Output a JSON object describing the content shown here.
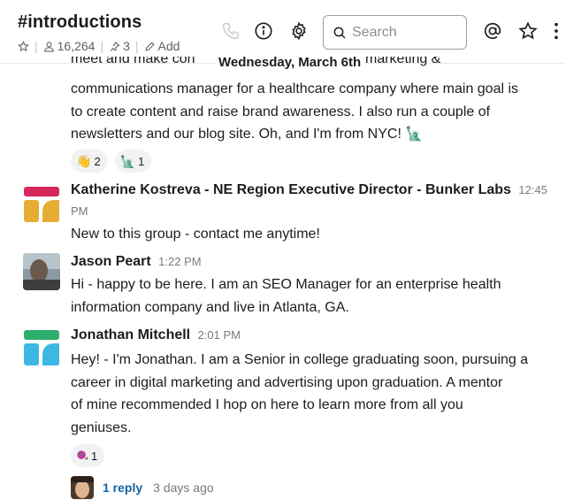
{
  "header": {
    "channel_name": "#introductions",
    "member_count": "16,264",
    "pinned_count": "3",
    "add_label": "Add",
    "search_placeholder": "Search",
    "icons": [
      "star-icon",
      "member-icon",
      "pin-icon",
      "pencil-icon",
      "phone-icon",
      "info-icon",
      "gear-icon",
      "search-icon",
      "at-icon",
      "star-icon",
      "more-vertical-icon"
    ]
  },
  "date_divider": "Wednesday, March 6th",
  "messages": [
    {
      "partial_top_left": "meet and make con",
      "partial_top_right": "marketing &",
      "lines": [
        "communications manager for a healthcare company where main goal is",
        "to create content and raise brand awareness. I also run a couple of",
        "newsletters and our blog site. Oh, and I'm from NYC! 🗽"
      ],
      "reactions": [
        {
          "emoji": "👋",
          "icon": "waving-hand-icon",
          "count": "2"
        },
        {
          "emoji": "🗽",
          "icon": "statue-of-liberty-icon",
          "count": "1"
        }
      ]
    },
    {
      "sender": "Katherine Kostreva - NE Region Executive Director - Bunker Labs",
      "time_a": "12:45",
      "time_b": "PM",
      "text": "New to this group - contact me anytime!",
      "avatar_colors": {
        "top": "#d6285a",
        "bottom": "#e5ad33"
      }
    },
    {
      "sender": "Jason Peart",
      "time": "1:22 PM",
      "lines": [
        "Hi - happy to be here. I am an SEO Manager for an enterprise health",
        "information company and live in Atlanta, GA."
      ]
    },
    {
      "sender": "Jonathan Mitchell",
      "time": "2:01 PM",
      "lines": [
        "Hey! - I'm Jonathan.  I am a Senior in college graduating soon, pursuing a",
        "career in digital marketing and advertising upon graduation.  A mentor",
        "of mine recommended I hop on here to learn more from all you",
        "geniuses."
      ],
      "avatar_colors": {
        "top": "#2eae6c",
        "bottom": "#3cb8e3"
      },
      "reactions": [
        {
          "emoji": "🐌",
          "icon": "custom-emoji-icon",
          "count": "1"
        }
      ],
      "thread": {
        "replies": "1 reply",
        "last_reply": "3 days ago"
      }
    }
  ]
}
